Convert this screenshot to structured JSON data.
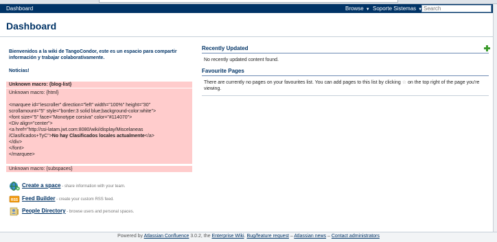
{
  "navbar": {
    "brand": "Dashboard",
    "browse_label": "Browse",
    "user_label": "Soporte Sistemas",
    "search_placeholder": "Search"
  },
  "page": {
    "title": "Dashboard"
  },
  "left": {
    "welcome": "Bienvenidos a la wiki de TangoCondor, este es un espacio para compartir información y trabajar colaborativamente.",
    "news": "Noticias!",
    "blog_error": "Unknown macro: {blog-list}",
    "html_error_title": "Unknown macro: {html}",
    "html_lines": [
      "<marquee id=\"iescroller\" direction=\"left\" width=\"100%\" height=\"30\"",
      "scrollamount=\"5\" style=\"border:3 solid blue;background-color:white\">",
      "<font size=\"5\" face=\"Monotype corsiva\" color=\"#114070\">",
      "<Div align=\"center\">",
      "<a href=\"http://ssi-latam.jwt.com:8080/wiki/display/Miscelaneas",
      "/Clasificados+TyC\">"
    ],
    "html_bold": "No hay Clasificados locales actualmente",
    "html_after_bold": "</a>",
    "html_tail": [
      "</div>",
      "</font>",
      "</marquee>"
    ],
    "subspaces_error": "Unknown macro: {subspaces}"
  },
  "quick_links": [
    {
      "icon": "create-space-icon",
      "label": "Create a space",
      "desc": " - share information with your team."
    },
    {
      "icon": "rss-feed-icon",
      "label": "Feed Builder",
      "desc": " - create your custom RSS feed."
    },
    {
      "icon": "people-directory-icon",
      "label": "People Directory",
      "desc": " - browse users and personal spaces."
    }
  ],
  "recently_updated": {
    "title": "Recently Updated",
    "empty": "No recently updated content found."
  },
  "favourites": {
    "title": "Favourite Pages",
    "text_before": "There are currently no pages on your favourites list. You can add pages to this list by clicking",
    "text_after": "on the top right of the page you're viewing."
  },
  "footer": {
    "powered": "Powered by ",
    "product": "Atlassian Confluence",
    "version": " 3.0.2, the ",
    "enterprise": "Enterprise Wiki",
    "sep1": ". ",
    "bug": "Bug/feature request",
    "sep2": " – ",
    "news": "Atlassian news",
    "sep3": " – ",
    "contact": "Contact administrators"
  },
  "colors": {
    "navbar": "#003366",
    "title": "#003366",
    "macro_error_bg": "#ffcccc",
    "add_icon": "#3a9a2a"
  }
}
